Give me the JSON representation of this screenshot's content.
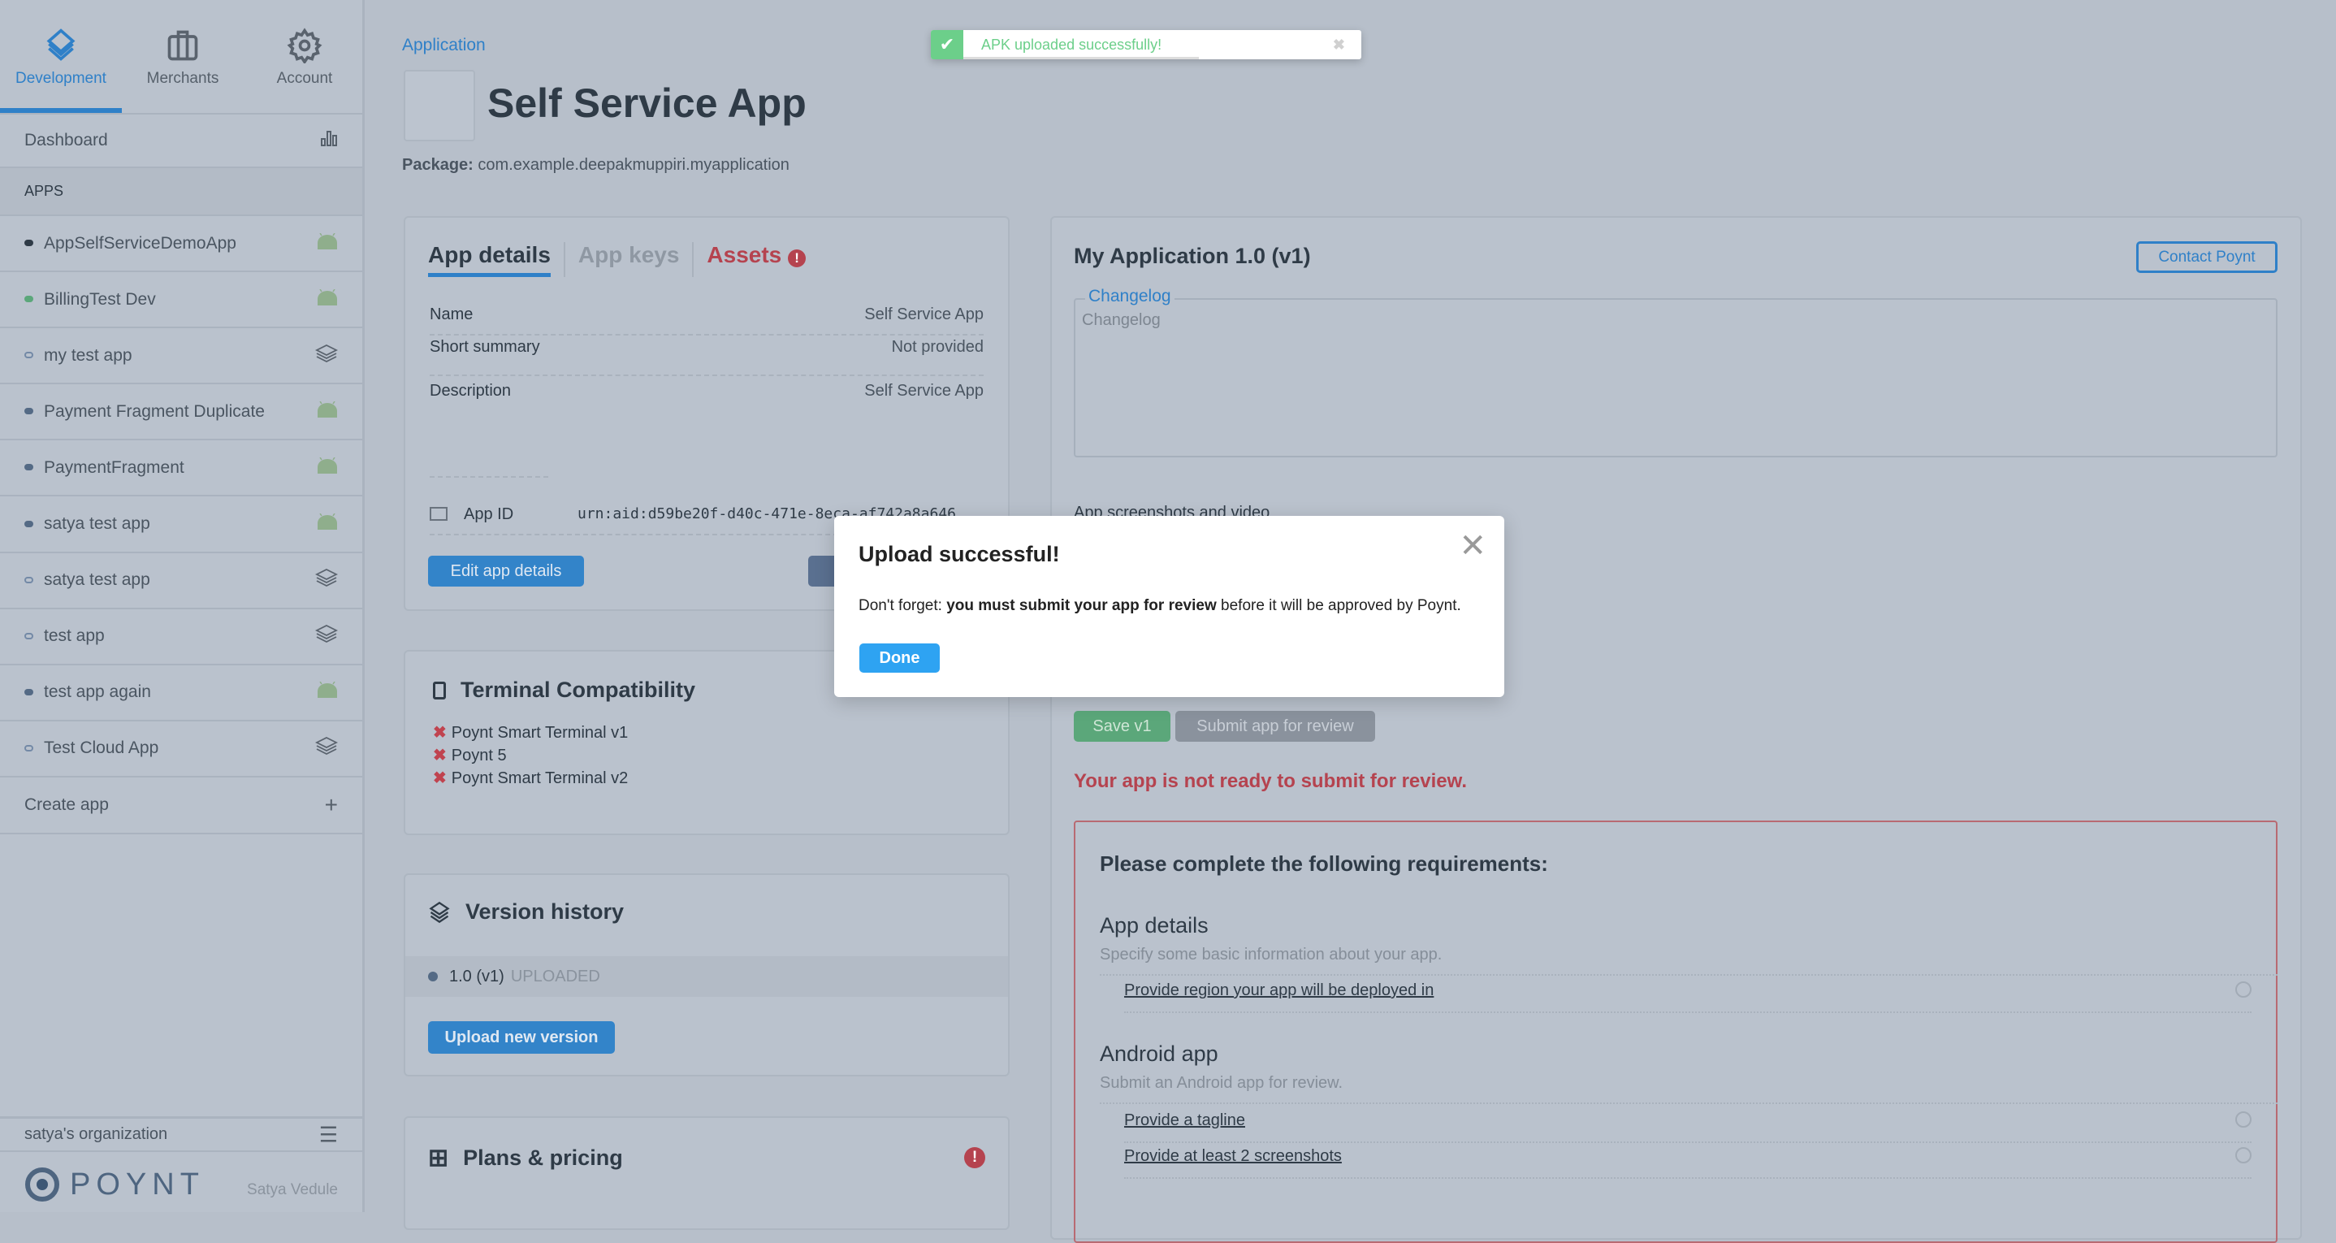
{
  "sidebar": {
    "nav": [
      {
        "label": "Development",
        "icon": "layers-icon",
        "active": true
      },
      {
        "label": "Merchants",
        "icon": "briefcase-icon"
      },
      {
        "label": "Account",
        "icon": "gear-icon"
      }
    ],
    "dashboard": "Dashboard",
    "apps_header": "APPS",
    "apps": [
      {
        "name": "AppSelfServiceDemoApp",
        "status": "dark",
        "type": "android"
      },
      {
        "name": "BillingTest Dev",
        "status": "green",
        "type": "android"
      },
      {
        "name": "my test app",
        "status": "hollow",
        "type": "cloud"
      },
      {
        "name": "Payment Fragment Duplicate",
        "status": "blue",
        "type": "android"
      },
      {
        "name": "PaymentFragment",
        "status": "blue",
        "type": "android"
      },
      {
        "name": "satya test app",
        "status": "blue",
        "type": "android"
      },
      {
        "name": "satya test app",
        "status": "hollow",
        "type": "cloud"
      },
      {
        "name": "test app",
        "status": "hollow",
        "type": "cloud"
      },
      {
        "name": "test app again",
        "status": "blue",
        "type": "android"
      },
      {
        "name": "Test Cloud App",
        "status": "hollow",
        "type": "cloud"
      }
    ],
    "create_app": "Create app",
    "org": "satya's organization",
    "logo": "POYNT",
    "user": "Satya Vedule"
  },
  "toast": {
    "message": "APK uploaded successfully!"
  },
  "header": {
    "breadcrumb": "Application",
    "title": "Self Service App",
    "package_label": "Package:",
    "package": "com.example.deepakmuppiri.myapplication"
  },
  "details": {
    "tabs": [
      {
        "label": "App details",
        "active": true
      },
      {
        "label": "App keys"
      },
      {
        "label": "Assets",
        "alert": true
      }
    ],
    "fields": [
      {
        "k": "Name",
        "v": "Self Service App"
      },
      {
        "k": "Short summary",
        "v": "Not provided"
      },
      {
        "k": "Description",
        "v": "Self Service App"
      }
    ],
    "app_id_label": "App ID",
    "app_id": "urn:aid:d59be20f-d40c-471e-8eca-af742a8a646",
    "edit_button": "Edit app details"
  },
  "terminal": {
    "title": "Terminal Compatibility",
    "items": [
      "Poynt Smart Terminal v1",
      "Poynt 5",
      "Poynt Smart Terminal v2"
    ]
  },
  "versions": {
    "title": "Version history",
    "items": [
      {
        "version": "1.0 (v1)",
        "status": "UPLOADED"
      }
    ],
    "upload_button": "Upload new version"
  },
  "plans": {
    "title": "Plans & pricing"
  },
  "release": {
    "title": "My Application 1.0 (v1)",
    "contact_button": "Contact Poynt",
    "changelog_legend": "Changelog",
    "changelog_placeholder": "Changelog",
    "screenshots_label": "App screenshots and video",
    "save_button": "Save v1",
    "submit_button": "Submit app for review",
    "not_ready": "Your app is not ready to submit for review."
  },
  "requirements": {
    "title": "Please complete the following requirements:",
    "sections": [
      {
        "title": "App details",
        "subtitle": "Specify some basic information about your app.",
        "items": [
          "Provide region your app will be deployed in"
        ]
      },
      {
        "title": "Android app",
        "subtitle": "Submit an Android app for review.",
        "items": [
          "Provide a tagline",
          "Provide at least 2 screenshots"
        ]
      }
    ]
  },
  "modal": {
    "title": "Upload successful!",
    "body_prefix": "Don't forget: ",
    "body_bold": "you must submit your app for review",
    "body_suffix": " before it will be approved by Poynt.",
    "done_button": "Done"
  },
  "colors": {
    "accent": "#2f80c8",
    "danger": "#b5434f",
    "success": "#6ccf8a",
    "done": "#2ea3f2"
  }
}
